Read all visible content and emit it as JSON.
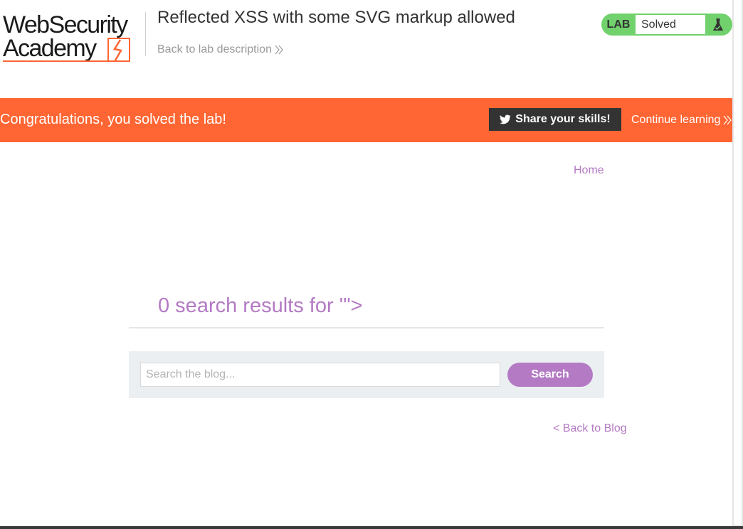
{
  "header": {
    "logo_line1": "WebSecurity",
    "logo_line2": "Academy",
    "lab_title": "Reflected XSS with some SVG markup allowed",
    "back_to_description": "Back to lab description"
  },
  "lab_status": {
    "label": "LAB",
    "status": "Solved",
    "icon": "flask-icon",
    "accent_color": "#70d16d"
  },
  "banner": {
    "message": "Congratulations, you solved the lab!",
    "share_label": "Share your skills!",
    "share_icon": "twitter-icon",
    "continue_label": "Continue learning",
    "color": "#ff6633"
  },
  "nav": {
    "home": "Home"
  },
  "main": {
    "results_title": "0 search results for '\">",
    "search_placeholder": "Search the blog...",
    "search_value": "",
    "search_button": "Search",
    "back_to_blog": "< Back to Blog",
    "accent_color": "#b47ac4"
  }
}
